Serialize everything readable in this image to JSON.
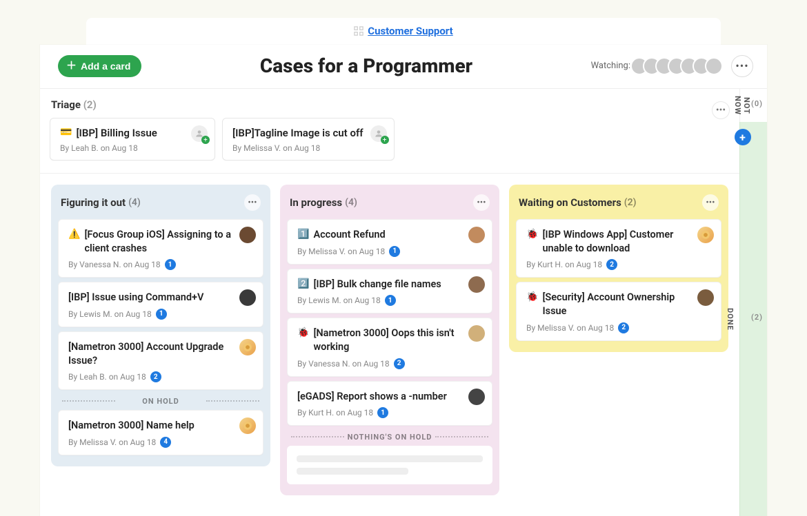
{
  "breadcrumb": {
    "label": "Customer Support"
  },
  "header": {
    "add_card": "Add a card",
    "title": "Cases for a Programmer",
    "watching_label": "Watching:",
    "watcher_count": 7
  },
  "rails": {
    "not_now": {
      "label": "NOT NOW",
      "count": "(0)"
    },
    "done": {
      "label": "DONE",
      "count": "(2)"
    }
  },
  "triage": {
    "title": "Triage",
    "count": "(2)",
    "cards": [
      {
        "emoji": "💳",
        "title": "[IBP] Billing Issue",
        "author": "Leah B.",
        "date": "Aug 18",
        "badge": null,
        "avatar": "empty"
      },
      {
        "emoji": "",
        "title": "[IBP]Tagline Image is cut off",
        "author": "Melissa V.",
        "date": "Aug 18",
        "badge": null,
        "avatar": "empty"
      }
    ]
  },
  "columns": {
    "figuring": {
      "name": "Figuring it out",
      "count": "(4)",
      "cards": [
        {
          "emoji": "⚠️",
          "title": "[Focus Group iOS] Assigning to a client crashes",
          "author": "Vanessa N.",
          "date": "Aug 18",
          "badge": "1",
          "avatar": "person1"
        },
        {
          "emoji": "",
          "title": "[IBP] Issue using Command+V",
          "author": "Lewis M.",
          "date": "Aug 18",
          "badge": "1",
          "avatar": "person2"
        },
        {
          "emoji": "",
          "title": "[Nametron 3000] Account Upgrade Issue?",
          "author": "Leah B.",
          "date": "Aug 18",
          "badge": "2",
          "avatar": "badge"
        }
      ],
      "divider": "ON HOLD",
      "hold_cards": [
        {
          "emoji": "",
          "title": "[Nametron 3000] Name help",
          "author": "Melissa V.",
          "date": "Aug 18",
          "badge": "4",
          "avatar": "badge"
        }
      ]
    },
    "progress": {
      "name": "In progress",
      "count": "(4)",
      "cards": [
        {
          "emoji": "1️⃣",
          "title": "Account Refund",
          "author": "Melissa V.",
          "date": "Aug 18",
          "badge": "1",
          "avatar": "person3"
        },
        {
          "emoji": "2️⃣",
          "title": "[IBP] Bulk change file names",
          "author": "Lewis M.",
          "date": "Aug 18",
          "badge": "1",
          "avatar": "person4"
        },
        {
          "emoji": "🐞",
          "title": "[Nametron 3000] Oops this isn't working",
          "author": "Vanessa N.",
          "date": "Aug 18",
          "badge": "2",
          "avatar": "person5"
        },
        {
          "emoji": "",
          "title": "[eGADS] Report shows a -number",
          "author": "Kurt H.",
          "date": "Aug 18",
          "badge": "1",
          "avatar": "person6"
        }
      ],
      "divider": "NOTHING'S ON HOLD"
    },
    "waiting": {
      "name": "Waiting on Customers",
      "count": "(2)",
      "cards": [
        {
          "emoji": "🐞",
          "title": "[IBP Windows App] Customer unable to download",
          "author": "Kurt H.",
          "date": "Aug 18",
          "badge": "2",
          "avatar": "badge"
        },
        {
          "emoji": "🐞",
          "title": "[Security] Account Ownership Issue",
          "author": "Melissa V.",
          "date": "Aug 18",
          "badge": "2",
          "avatar": "person7"
        }
      ]
    }
  },
  "meta_prefix": "By ",
  "meta_on": " on "
}
